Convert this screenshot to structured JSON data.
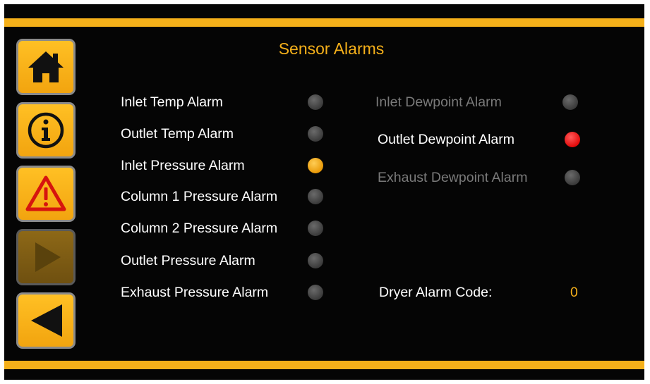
{
  "header": {
    "title": "Sensor Alarms"
  },
  "colors": {
    "accent": "#f5b01a",
    "led_off": "#3b3b3b",
    "led_warning": "#f2a40f",
    "led_alarm": "#e20b0b"
  },
  "nav": [
    {
      "icon": "home-icon"
    },
    {
      "icon": "info-icon"
    },
    {
      "icon": "warning-icon"
    },
    {
      "icon": "play-icon",
      "state": "disabled"
    },
    {
      "icon": "back-arrow-icon"
    }
  ],
  "left_alarms": [
    {
      "label": "Inlet Temp Alarm",
      "state": "off"
    },
    {
      "label": "Outlet Temp Alarm",
      "state": "off"
    },
    {
      "label": "Inlet Pressure Alarm",
      "state": "warning"
    },
    {
      "label": "Column 1 Pressure Alarm",
      "state": "off"
    },
    {
      "label": "Column 2 Pressure Alarm",
      "state": "off"
    },
    {
      "label": "Outlet Pressure Alarm",
      "state": "off"
    },
    {
      "label": "Exhaust Pressure Alarm",
      "state": "off"
    }
  ],
  "right_alarms": [
    {
      "label": "Inlet Dewpoint Alarm",
      "state": "off",
      "enabled": false
    },
    {
      "label": "Outlet Dewpoint Alarm",
      "state": "alarm",
      "enabled": true
    },
    {
      "label": "Exhaust Dewpoint Alarm",
      "state": "off",
      "enabled": false
    }
  ],
  "dryer_alarm_code": {
    "label": "Dryer Alarm Code:",
    "value": "0"
  }
}
